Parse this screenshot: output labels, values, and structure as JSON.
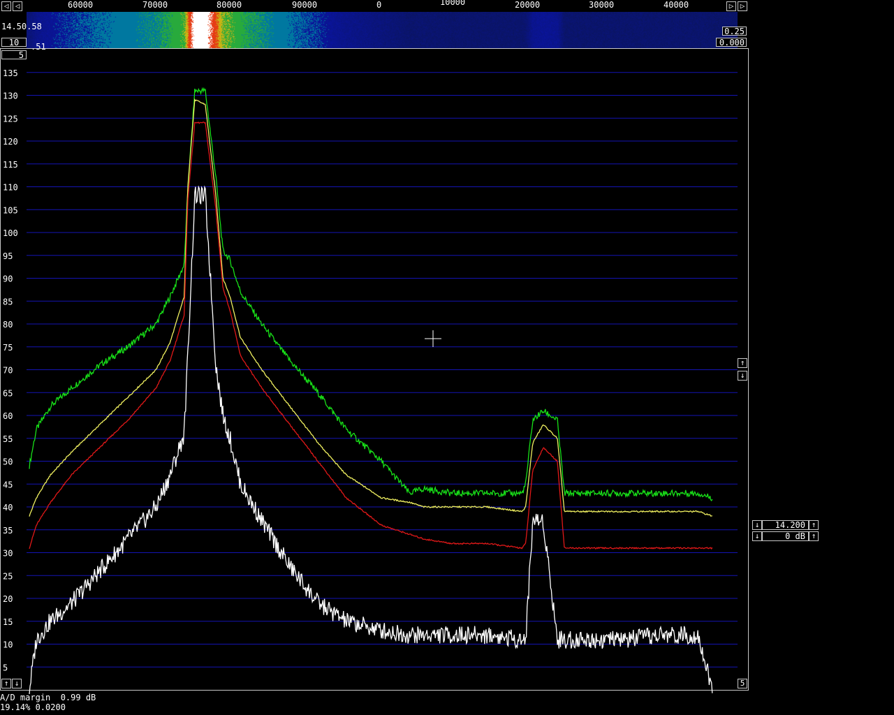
{
  "header": {
    "freq_ticks_left": [
      "60000",
      "70000",
      "80000",
      "90000",
      "0"
    ],
    "freq_ticks_right": [
      "10000",
      "20000",
      "30000",
      "40000"
    ],
    "scroll_left_buttons": [
      "◁",
      "◁"
    ],
    "scroll_right_buttons": [
      "▷",
      "▷"
    ]
  },
  "waterfall": {
    "time_label": "14.50.58",
    "time_label_2": ".51",
    "speed_value": "10",
    "gain_value": "5",
    "right_value_1": "0.25",
    "right_value_2": "0.000"
  },
  "side_controls": {
    "up_arrow": "↑",
    "down_arrow": "↓",
    "freq_value": "14.200",
    "gain_db": "0 dB",
    "bottom_left_up": "↑",
    "bottom_left_down": "↓",
    "bottom_right_value": "5"
  },
  "status": {
    "line1": "A/D margin  0.99 dB",
    "line2": "19.14% 0.0200"
  },
  "colors": {
    "grid": "#1414b4",
    "green": "#18e018",
    "yellow": "#f0f060",
    "red": "#e01818",
    "white": "#ffffff",
    "frame": "#c8c8c8"
  },
  "chart_data": {
    "type": "line",
    "title": "",
    "xlabel": "",
    "ylabel": "",
    "y_ticks": [
      "5",
      "10",
      "15",
      "20",
      "25",
      "30",
      "35",
      "40",
      "45",
      "50",
      "55",
      "60",
      "65",
      "70",
      "75",
      "80",
      "85",
      "90",
      "95",
      "100",
      "105",
      "110",
      "115",
      "120",
      "125",
      "130",
      "135"
    ],
    "ylim": [
      0,
      139
    ],
    "grid": true,
    "x_positions": [
      0,
      0.01,
      0.03,
      0.06,
      0.1,
      0.14,
      0.18,
      0.2,
      0.22,
      0.225,
      0.235,
      0.25,
      0.265,
      0.275,
      0.285,
      0.3,
      0.33,
      0.37,
      0.41,
      0.45,
      0.5,
      0.54,
      0.56,
      0.6,
      0.65,
      0.7,
      0.705,
      0.715,
      0.73,
      0.75,
      0.76,
      0.77,
      0.8,
      0.85,
      0.9,
      0.95,
      0.97
    ],
    "series": [
      {
        "color": "#18e018",
        "values": [
          49,
          57,
          62,
          66,
          71,
          75,
          80,
          86,
          93,
          109,
          131,
          131,
          112,
          96,
          94,
          87,
          80,
          72,
          65,
          57,
          50,
          43,
          44,
          43,
          43,
          43,
          45,
          59,
          61,
          59,
          43,
          43,
          43,
          43,
          43,
          43,
          42
        ]
      },
      {
        "color": "#f0f060",
        "values": [
          38,
          42,
          47,
          52,
          58,
          64,
          70,
          76,
          86,
          110,
          129,
          128,
          108,
          90,
          86,
          77,
          70,
          62,
          54,
          47,
          42,
          41,
          40,
          40,
          40,
          39,
          40,
          54,
          58,
          55,
          39,
          39,
          39,
          39,
          39,
          39,
          38
        ]
      },
      {
        "color": "#e01818",
        "values": [
          31,
          36,
          41,
          47,
          53,
          59,
          66,
          72,
          82,
          107,
          124,
          124,
          105,
          88,
          83,
          73,
          66,
          58,
          50,
          42,
          36,
          34,
          33,
          32,
          32,
          31,
          32,
          48,
          53,
          50,
          31,
          31,
          31,
          31,
          31,
          31,
          31
        ]
      },
      {
        "color": "#ffffff",
        "values": [
          0,
          11,
          15,
          19,
          26,
          33,
          40,
          47,
          56,
          73,
          108,
          108,
          71,
          60,
          55,
          45,
          37,
          27,
          19,
          15,
          13,
          12,
          12,
          12,
          12,
          11,
          11,
          37,
          37,
          11,
          11,
          11,
          11,
          11,
          12,
          12,
          0
        ]
      }
    ]
  }
}
